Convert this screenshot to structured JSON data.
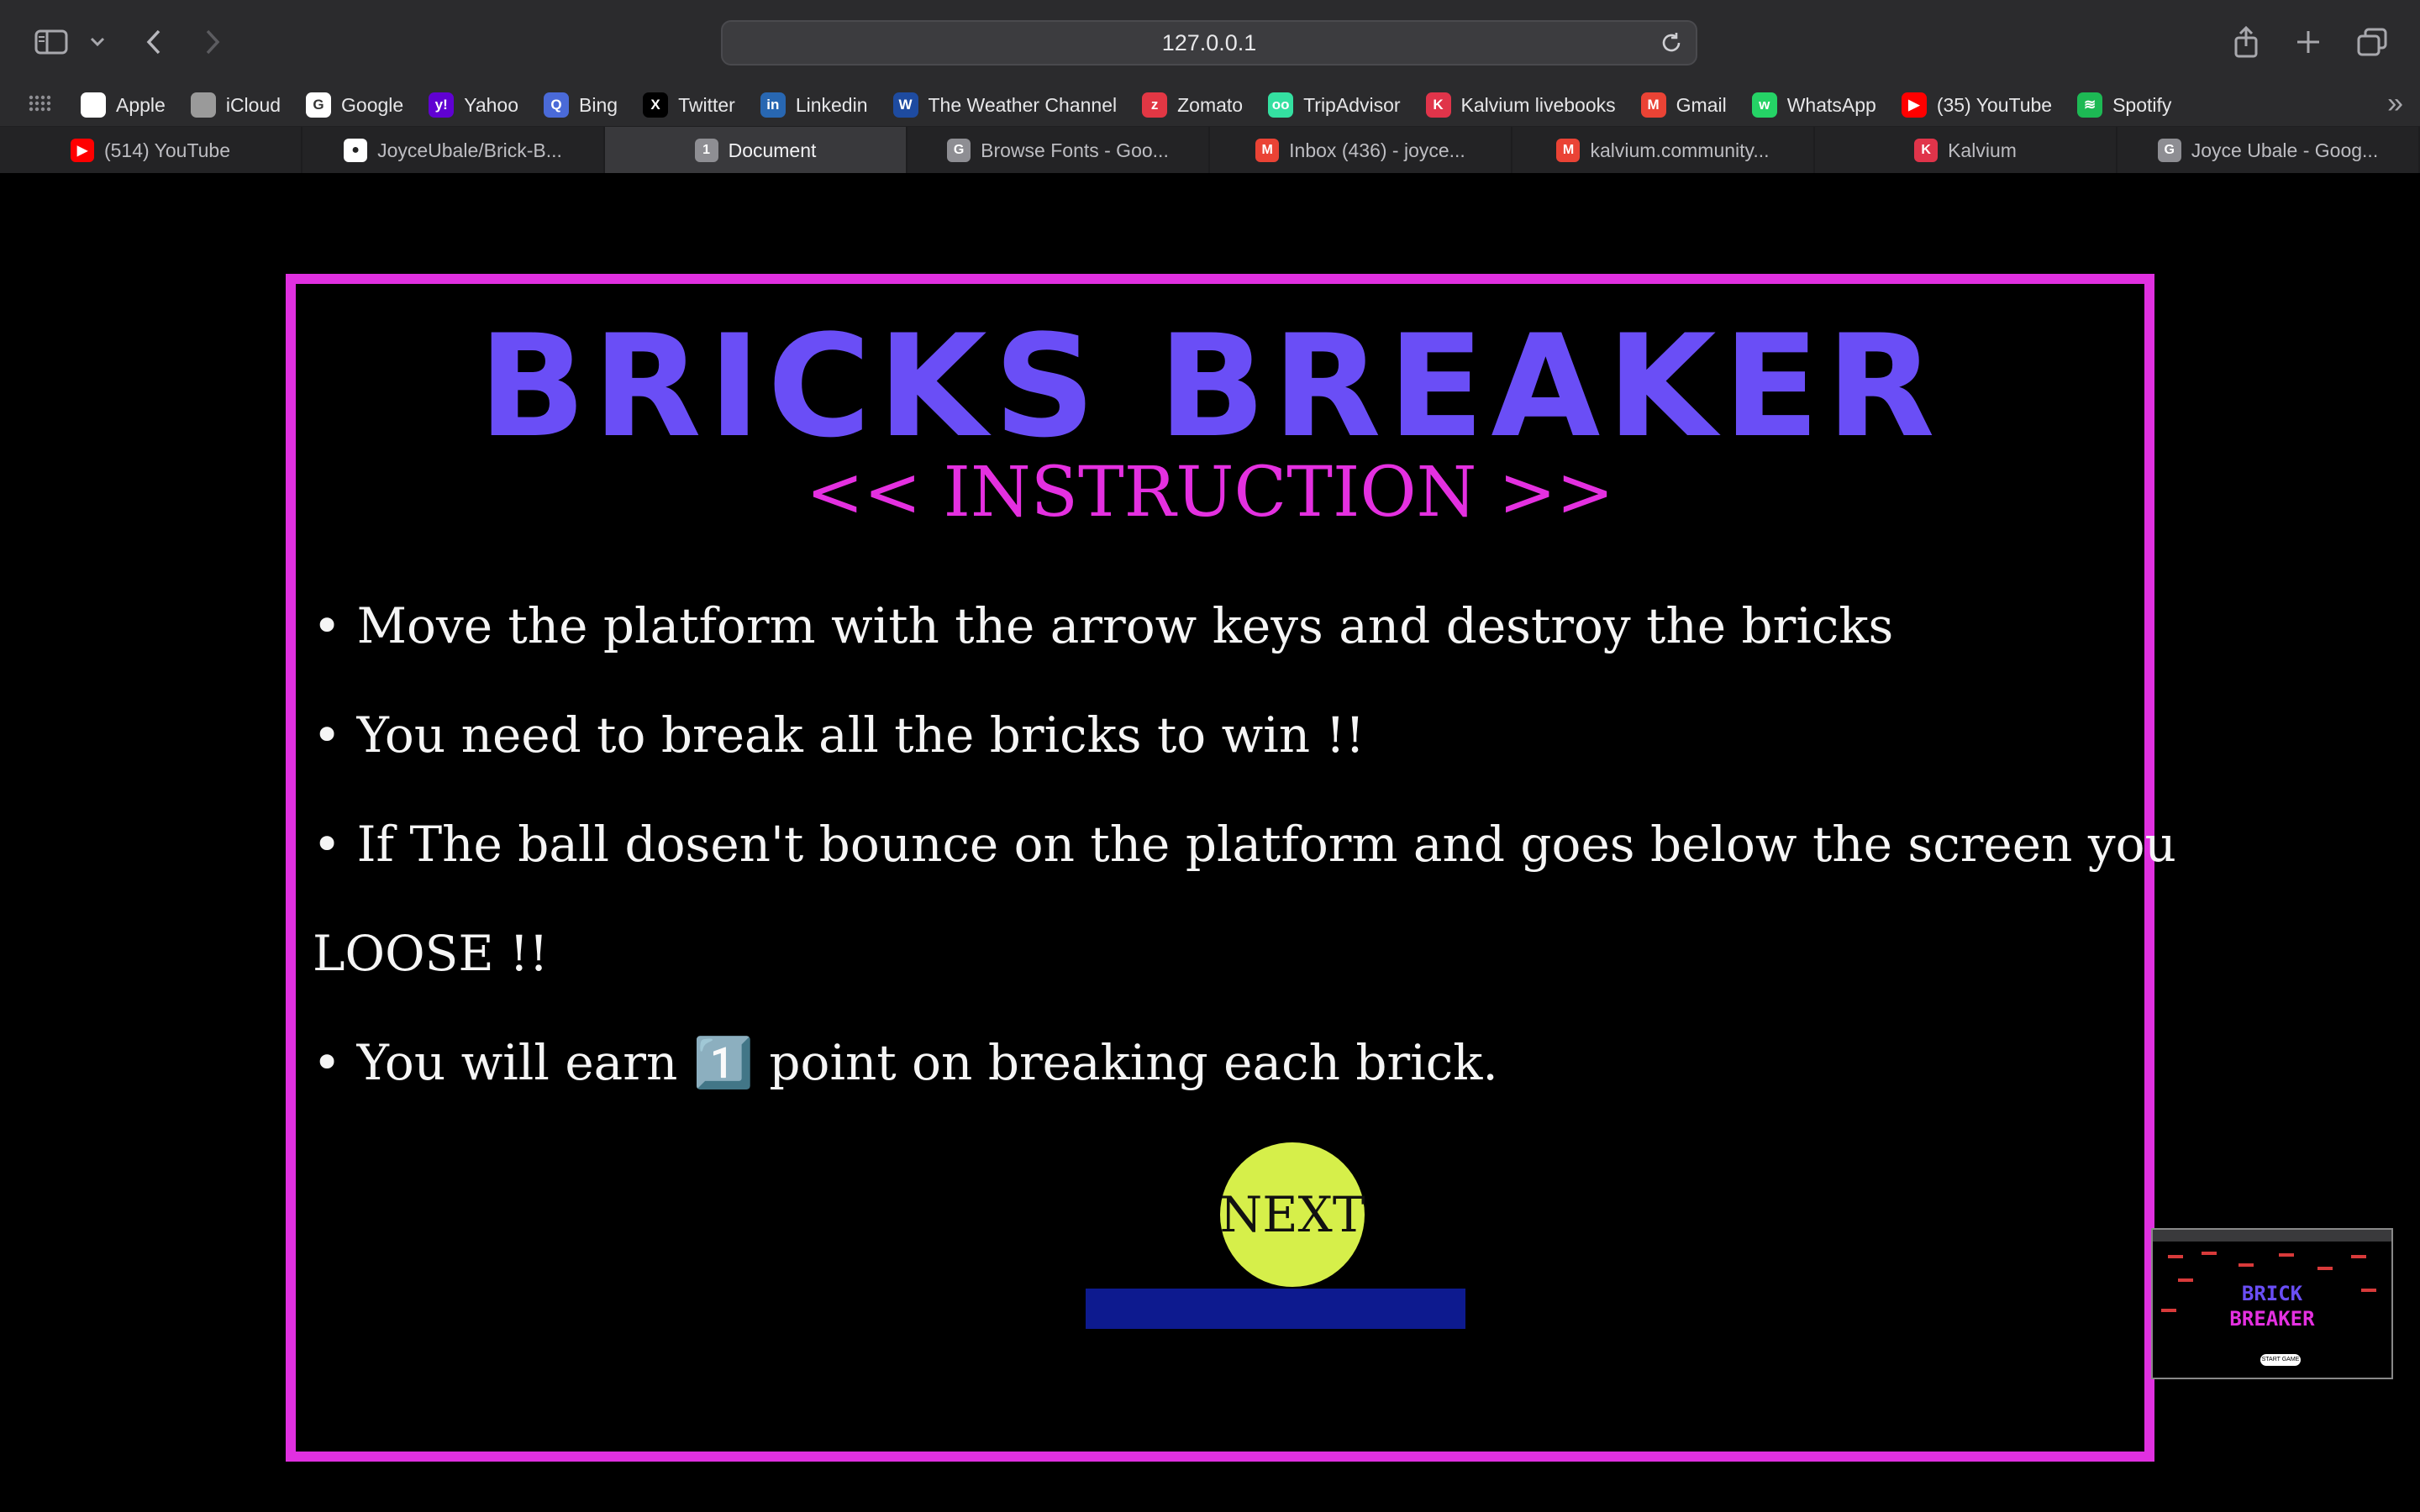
{
  "browser": {
    "address": "127.0.0.1",
    "bookmarks": [
      {
        "label": "Apple",
        "icon": "apple-icon",
        "color": "#ffffff",
        "glyph": ""
      },
      {
        "label": "iCloud",
        "icon": "apple-icon",
        "color": "#9a9a9a",
        "glyph": ""
      },
      {
        "label": "Google",
        "icon": "google-icon",
        "color": "#ffffff",
        "glyph": "G"
      },
      {
        "label": "Yahoo",
        "icon": "yahoo-icon",
        "color": "#6001d2",
        "glyph": "y!"
      },
      {
        "label": "Bing",
        "icon": "bing-icon",
        "color": "#4a6ad8",
        "glyph": "Q"
      },
      {
        "label": "Twitter",
        "icon": "x-icon",
        "color": "#000000",
        "glyph": "X"
      },
      {
        "label": "Linkedin",
        "icon": "linkedin-icon",
        "color": "#2867b2",
        "glyph": "in"
      },
      {
        "label": "The Weather Channel",
        "icon": "weather-channel-icon",
        "color": "#1e4ba0",
        "glyph": "W"
      },
      {
        "label": "Zomato",
        "icon": "zomato-icon",
        "color": "#e23744",
        "glyph": "z"
      },
      {
        "label": "TripAdvisor",
        "icon": "tripadvisor-icon",
        "color": "#34e0a1",
        "glyph": "oo"
      },
      {
        "label": "Kalvium livebooks",
        "icon": "kalvium-icon",
        "color": "#e0344a",
        "glyph": "K"
      },
      {
        "label": "Gmail",
        "icon": "gmail-icon",
        "color": "#ea4335",
        "glyph": "M"
      },
      {
        "label": "WhatsApp",
        "icon": "whatsapp-icon",
        "color": "#25d366",
        "glyph": "w"
      },
      {
        "label": "(35) YouTube",
        "icon": "youtube-icon",
        "color": "#ff0000",
        "glyph": "▶"
      },
      {
        "label": "Spotify",
        "icon": "spotify-icon",
        "color": "#1db954",
        "glyph": "≋"
      }
    ],
    "tabs": [
      {
        "label": "(514) YouTube",
        "icon": "youtube-icon",
        "color": "#ff0000",
        "glyph": "▶",
        "active": false
      },
      {
        "label": "JoyceUbale/Brick-B...",
        "icon": "github-icon",
        "color": "#ffffff",
        "glyph": "●",
        "active": false
      },
      {
        "label": "Document",
        "icon": "document-icon",
        "color": "#8e8e93",
        "glyph": "1",
        "active": true
      },
      {
        "label": "Browse Fonts - Goo...",
        "icon": "google-fonts-icon",
        "color": "#8e8e93",
        "glyph": "G",
        "active": false
      },
      {
        "label": "Inbox (436) - joyce...",
        "icon": "gmail-icon",
        "color": "#ea4335",
        "glyph": "M",
        "active": false
      },
      {
        "label": "kalvium.community...",
        "icon": "gmail-icon",
        "color": "#ea4335",
        "glyph": "M",
        "active": false
      },
      {
        "label": "Kalvium",
        "icon": "kalvium-icon",
        "color": "#e0344a",
        "glyph": "K",
        "active": false
      },
      {
        "label": "Joyce Ubale - Goog...",
        "icon": "google-icon",
        "color": "#8e8e93",
        "glyph": "G",
        "active": false
      }
    ]
  },
  "game": {
    "title": "BRICKS BREAKER",
    "subtitle": "<< INSTRUCTION >>",
    "instructions": [
      "• Move the platform with the arrow keys and destroy the bricks",
      "• You need to break all the bricks to win !!",
      "• If The ball dosen't bounce on the platform and goes below the screen you",
      "LOOSE !!",
      "• You will earn 1️⃣ point on breaking each brick."
    ],
    "next_label": "NEXT",
    "colors": {
      "title": "#6a4ef6",
      "subtitle": "#e430e0",
      "frame": "#e030e0",
      "ball": "#d6ef4a",
      "paddle": "#0d1a8f"
    }
  },
  "thumbnail": {
    "title_line1": "BRICK",
    "title_line2": "BREAKER",
    "button": "START GAME"
  }
}
